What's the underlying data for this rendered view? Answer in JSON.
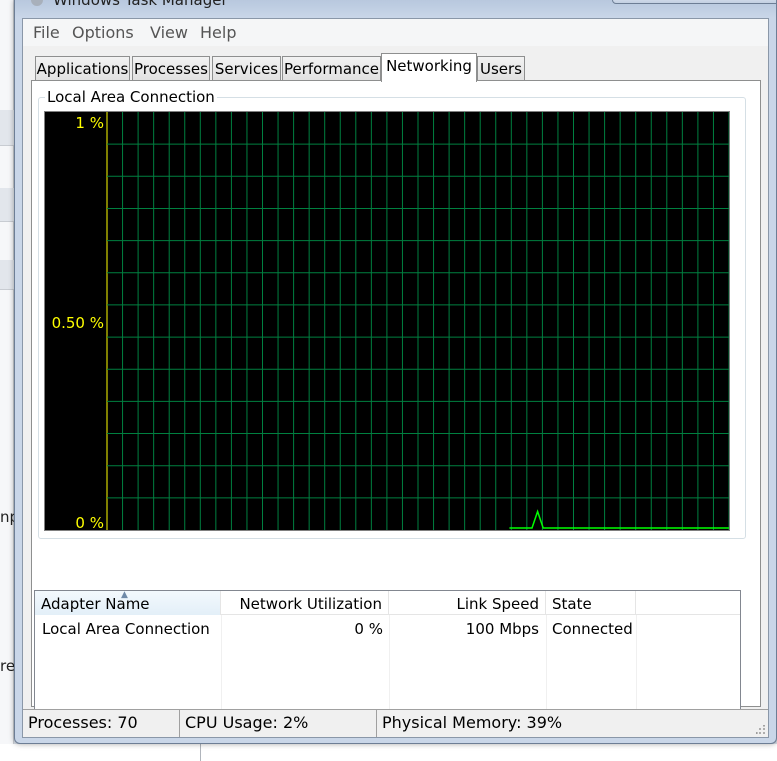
{
  "window": {
    "title": "Windows Task Manager"
  },
  "background": {
    "left_fragment_1": "np",
    "left_fragment_2": "re"
  },
  "menu": {
    "items": [
      "File",
      "Options",
      "View",
      "Help"
    ]
  },
  "tabs": [
    {
      "label": "Applications"
    },
    {
      "label": "Processes"
    },
    {
      "label": "Services"
    },
    {
      "label": "Performance"
    },
    {
      "label": "Networking",
      "active": true
    },
    {
      "label": "Users"
    }
  ],
  "networking": {
    "group_label": "Local Area Connection",
    "graph": {
      "y_labels": {
        "top": "1 %",
        "middle": "0.50 %",
        "bottom": "0 %"
      },
      "grid_color": "#008040",
      "line_color": "#00ff00",
      "label_color": "#ffff00",
      "background": "#000000"
    }
  },
  "chart_data": {
    "type": "line",
    "title": "",
    "xlabel": "",
    "ylabel": "",
    "ylim": [
      0,
      1
    ],
    "y_ticks": [
      "1 %",
      "0.50 %",
      "0 %"
    ],
    "grid": true,
    "series": [
      {
        "values": [
          0,
          0,
          0,
          0,
          0,
          0.03,
          0,
          0,
          0,
          0,
          0,
          0,
          0,
          0,
          0,
          0,
          0,
          0,
          0,
          0,
          0,
          0,
          0,
          0,
          0,
          0,
          0,
          0,
          0,
          0,
          0,
          0,
          0,
          0,
          0,
          0,
          0,
          0,
          0,
          0
        ],
        "color": "#00ff00"
      }
    ]
  },
  "adapters": {
    "columns": [
      {
        "label": "Adapter Name",
        "sorted": true
      },
      {
        "label": "Network Utilization"
      },
      {
        "label": "Link Speed"
      },
      {
        "label": "State"
      }
    ],
    "rows": [
      {
        "name": "Local Area Connection",
        "utilization": "0 %",
        "speed": "100 Mbps",
        "state": "Connected"
      }
    ]
  },
  "status": {
    "processes": "Processes: 70",
    "cpu": "CPU Usage: 2%",
    "memory": "Physical Memory: 39%"
  }
}
